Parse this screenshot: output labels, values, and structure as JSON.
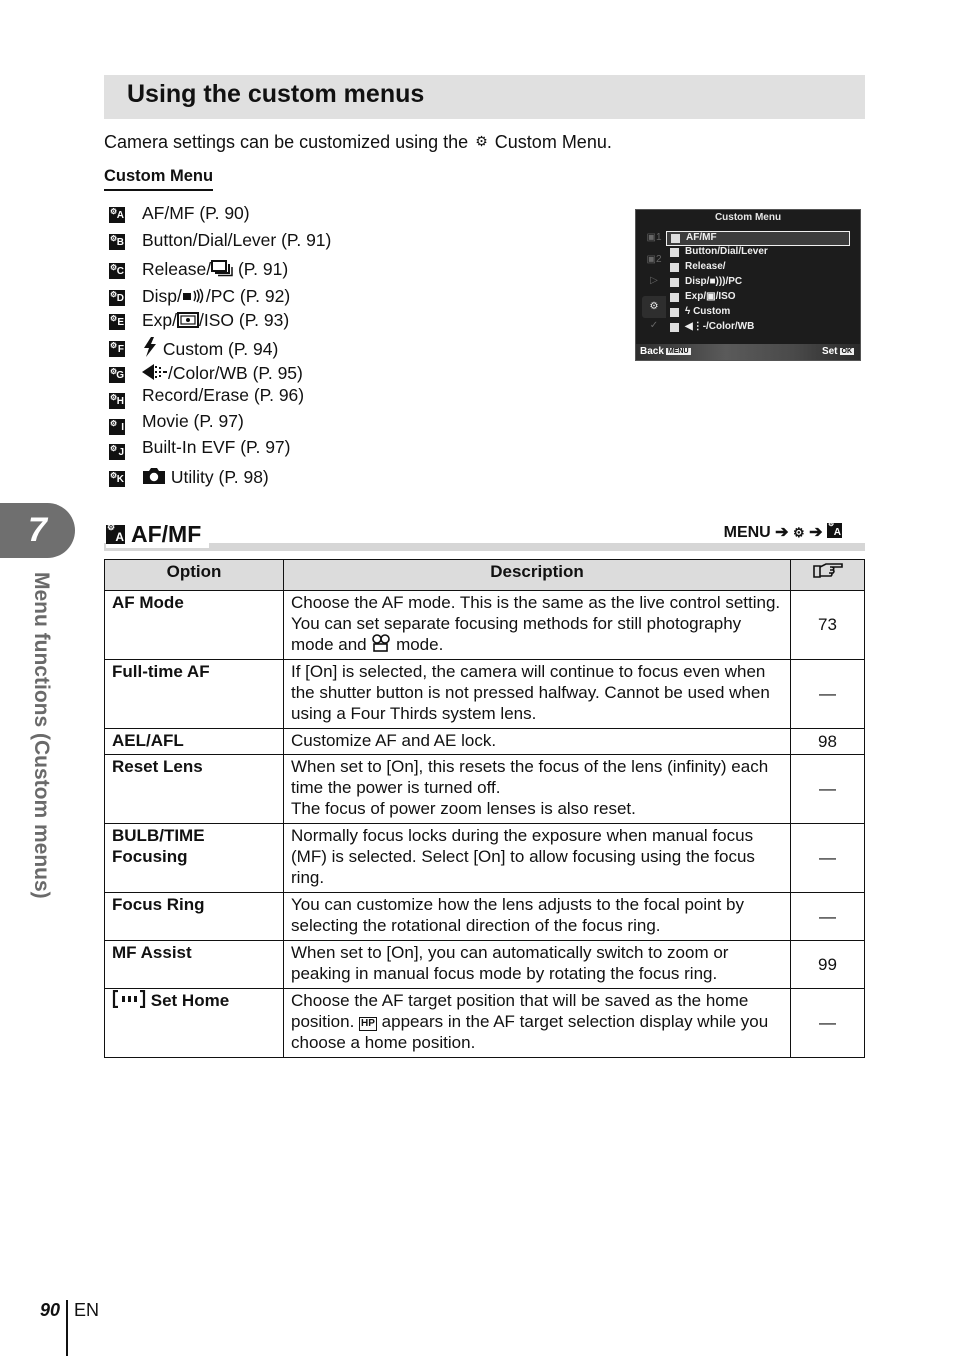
{
  "chapter": {
    "number": "7",
    "title": "Menu functions (Custom menus)"
  },
  "heading": "Using the custom menus",
  "intro": {
    "before": "Camera settings can be customized using the",
    "icon": "custom-menu-gear-icon",
    "after": "Custom Menu."
  },
  "custom_menu_label": "Custom Menu",
  "custom_menu_items": [
    {
      "badge": "A",
      "icon": "",
      "label": "AF/MF (P. 90)"
    },
    {
      "badge": "B",
      "icon": "",
      "label": "Button/Dial/Lever (P. 91)"
    },
    {
      "badge": "C",
      "icon": "sequential-shooting-icon",
      "label_before": "Release/",
      "label": " (P. 91)"
    },
    {
      "badge": "D",
      "icon": "sound-icon",
      "label_before": "Disp/",
      "label": "/PC (P. 92)"
    },
    {
      "badge": "E",
      "icon": "metering-icon",
      "label_before": "Exp/",
      "label": "/ISO (P. 93)"
    },
    {
      "badge": "F",
      "icon": "flash-icon",
      "label": " Custom (P. 94)"
    },
    {
      "badge": "G",
      "icon": "image-quality-icon",
      "label": "/Color/WB (P. 95)"
    },
    {
      "badge": "H",
      "icon": "",
      "label": "Record/Erase (P. 96)"
    },
    {
      "badge": "I",
      "icon": "",
      "label": "Movie (P. 97)"
    },
    {
      "badge": "J",
      "icon": "",
      "label": "Built-In EVF (P. 97)"
    },
    {
      "badge": "K",
      "icon": "camera-icon",
      "label": " Utility (P. 98)"
    }
  ],
  "camera_screen": {
    "title": "Custom Menu",
    "side_tabs": [
      "shooting-menu-1-icon",
      "shooting-menu-2-icon",
      "playback-menu-icon",
      "custom-menu-icon",
      "setup-menu-icon"
    ],
    "side_tab_labels": [
      "1",
      "2",
      "",
      "",
      ""
    ],
    "active_tab": 3,
    "rows": [
      "AF/MF",
      "Button/Dial/Lever",
      "Release/",
      "Disp/■)))/PC",
      "Exp/▣/ISO",
      "ϟ Custom",
      "◀⋮-/Color/WB"
    ],
    "selected_row": 0,
    "back_label": "Back",
    "back_key": "MENU",
    "set_label": "Set",
    "set_key": "OK"
  },
  "section": {
    "badge": "A",
    "title": "AF/MF",
    "menu_path": {
      "menu": "MENU",
      "arrow": "➔"
    }
  },
  "table": {
    "headers": {
      "option": "Option",
      "description": "Description",
      "ref_icon": "page-reference-icon"
    },
    "rows": [
      {
        "option": "AF Mode",
        "description_before": "Choose the AF mode. This is the same as the live control setting. You can set separate focusing methods for still photography mode and ",
        "description_icon": "movie-icon",
        "description_after": " mode.",
        "ref": "73"
      },
      {
        "option": "Full-time AF",
        "description": "If [On] is selected, the camera will continue to focus even when the shutter button is not pressed halfway. Cannot be used when using a Four Thirds system lens.",
        "ref": "—"
      },
      {
        "option": "AEL/AFL",
        "description": "Customize AF and AE lock.",
        "ref": "98"
      },
      {
        "option": "Reset Lens",
        "description": "When set to [On], this resets the focus of the lens (infinity) each time the power is turned off.",
        "description_line2": "The focus of power zoom lenses is also reset.",
        "ref": "—"
      },
      {
        "option": "BULB/TIME",
        "option_line2": "Focusing",
        "description": "Normally focus locks during the exposure when manual focus (MF) is selected. Select [On] to allow focusing using the focus ring.",
        "ref": "—"
      },
      {
        "option": "Focus Ring",
        "description": "You can customize how the lens adjusts to the focal point by selecting the rotational direction of the focus ring.",
        "ref": "—"
      },
      {
        "option": "MF Assist",
        "description": "When set to [On], you can automatically switch to zoom or peaking in manual focus mode by rotating the focus ring.",
        "ref": "99"
      },
      {
        "option_icon": "af-target-icon",
        "option": "Set Home",
        "description_before": "Choose the AF target position that will be saved as the home position. ",
        "description_badge": "HP",
        "description_after": " appears in the AF target selection display while you choose a home position.",
        "ref": "—"
      }
    ]
  },
  "footer": {
    "page": "90",
    "lang": "EN"
  }
}
